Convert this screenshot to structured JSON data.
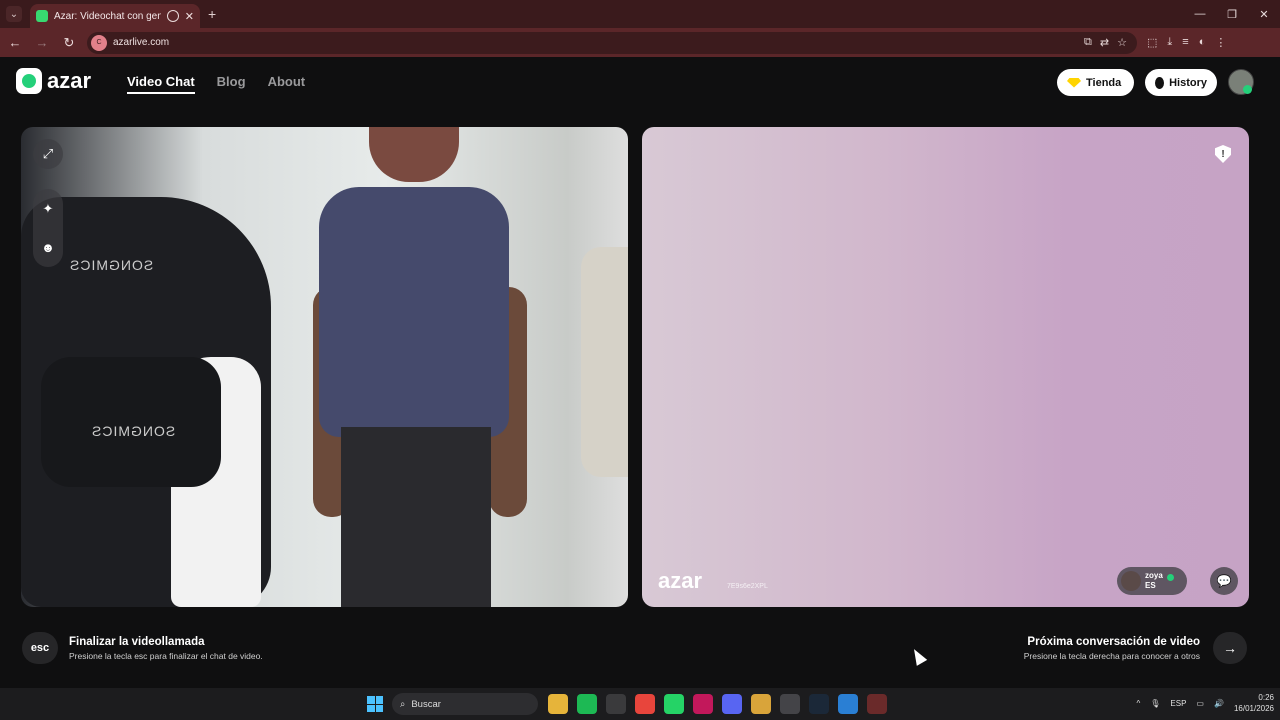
{
  "browser": {
    "tab_title": "Azar: Videochat con gente",
    "url": "azarlive.com",
    "site_badge": "C",
    "new_tab": "+",
    "tab_close": "✕",
    "minimize": "—",
    "maximize": "❐",
    "close": "✕"
  },
  "site": {
    "logo_text": "azar",
    "nav": [
      "Video Chat",
      "Blog",
      "About"
    ],
    "tienda_label": "Tienda",
    "history_label": "History"
  },
  "remote": {
    "logo_text": "azar",
    "session_id": "7E9s6e2XPL",
    "peer_name": "zoya",
    "peer_lang": "ES"
  },
  "hints": {
    "esc_key": "esc",
    "end_title": "Finalizar la videollamada",
    "end_sub": "Presione la tecla esc para finalizar el chat de video.",
    "next_title": "Próxima conversación de video",
    "next_sub": "Presione la tecla derecha para conocer a otros",
    "next_icon": "→"
  },
  "self_view": {
    "brand_top": "SONGMICS",
    "brand_bottom": "SONGMICS"
  },
  "taskbar": {
    "search_placeholder": "Buscar",
    "lang": "ESP",
    "time": "0:26",
    "date": "16/01/2026",
    "apps": [
      {
        "icon": "file-explorer-icon",
        "color": "#e6b43a"
      },
      {
        "icon": "spotify-icon",
        "color": "#1db954"
      },
      {
        "icon": "store-icon",
        "color": "#3a3a3c"
      },
      {
        "icon": "chrome-icon",
        "color": "#e8453c"
      },
      {
        "icon": "whatsapp-icon",
        "color": "#25d366"
      },
      {
        "icon": "app-pink-icon",
        "color": "#c2185b"
      },
      {
        "icon": "discord-icon",
        "color": "#5865f2"
      },
      {
        "icon": "chrome-active-icon",
        "color": "#d9a43a"
      },
      {
        "icon": "obs-icon",
        "color": "#444448"
      },
      {
        "icon": "steam-icon",
        "color": "#1b2838"
      },
      {
        "icon": "photos-icon",
        "color": "#2a7fd4"
      },
      {
        "icon": "game-icon",
        "color": "#6a2a2a"
      }
    ]
  },
  "colors": {
    "accent_green": "#24d07a",
    "tab_bar": "#3a1a1c",
    "address_bar": "#5b2629"
  }
}
